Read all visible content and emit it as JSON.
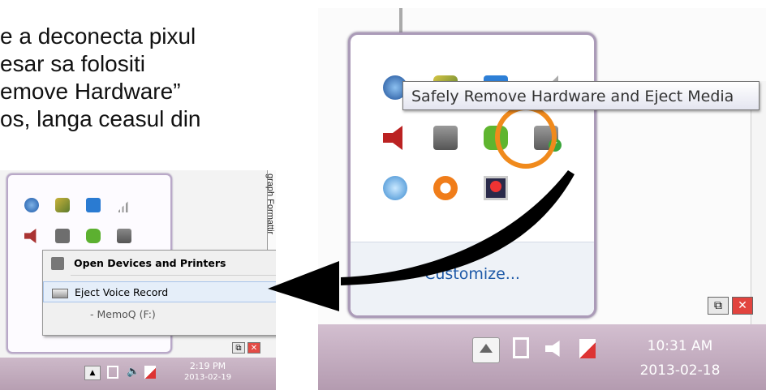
{
  "instructions": {
    "lines": [
      "e a deconecta pixul",
      "esar sa folositi",
      "emove Hardware”",
      "os, langa ceasul din"
    ]
  },
  "small_screenshot": {
    "side_label": "graph Formattir",
    "context_menu": {
      "items": [
        {
          "label": "Open Devices and Printers",
          "icon": "printer-icon"
        },
        {
          "label": "Eject Voice Record",
          "icon": "drive-icon"
        },
        {
          "label": "- MemoQ (F:)",
          "icon": ""
        }
      ]
    },
    "clock": {
      "time": "2:19 PM",
      "date": "2013-02-19"
    },
    "window_buttons": [
      "restore-icon",
      "close-icon"
    ]
  },
  "large_screenshot": {
    "tooltip": "Safely Remove Hardware and Eject Media",
    "customize_link": "Customize...",
    "clock": {
      "time": "10:31 AM",
      "date": "2013-02-18"
    },
    "tray_icons": [
      "bluetooth-icon",
      "network-icon",
      "wifi-icon",
      "signal-icon",
      "volume-icon",
      "printer-icon",
      "messenger-icon",
      "safely-remove-icon",
      "update-icon",
      "avast-icon",
      "monitor-blocked-icon"
    ],
    "highlight_color": "#f08a1c"
  },
  "colors": {
    "taskbar": "#c2adbf",
    "popup_border": "#ab9bb8",
    "link": "#1e5aa8",
    "highlight": "#f08a1c"
  }
}
